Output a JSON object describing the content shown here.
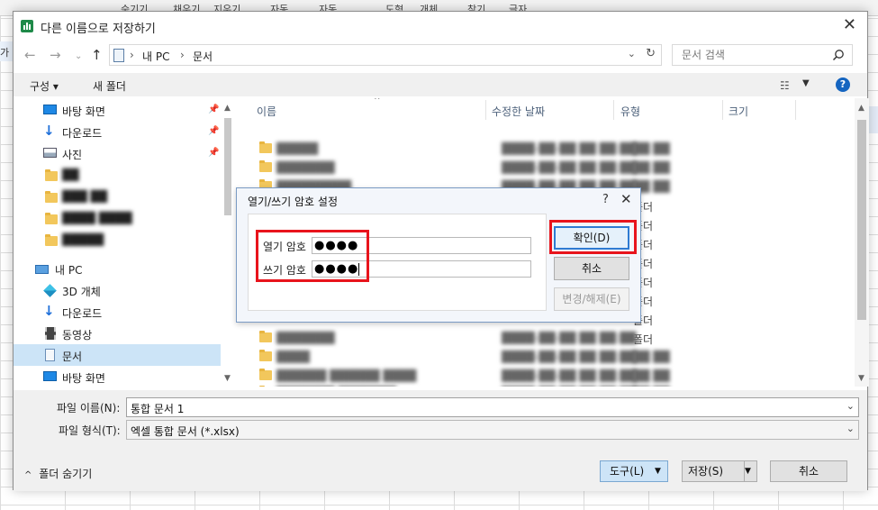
{
  "background": {
    "ribbon_items": [
      "숨기기",
      "채우기",
      "지우기",
      "자동",
      "자동",
      "도형",
      "개체",
      "찾기",
      "글자"
    ],
    "left_cell_text": "가"
  },
  "dialog": {
    "title": "다른 이름으로 저장하기",
    "close_label": "✕",
    "address": {
      "path_parts": [
        "내 PC",
        "문서"
      ]
    },
    "search": {
      "placeholder": "문서 검색"
    },
    "toolbar": {
      "organize_label": "구성 ▾",
      "new_folder_label": "새 폴더",
      "help_label": "?"
    },
    "nav": {
      "items": [
        {
          "label": "바탕 화면",
          "icon": "desktop-icon",
          "pinned": true
        },
        {
          "label": "다운로드",
          "icon": "download-icon",
          "pinned": true
        },
        {
          "label": "사진",
          "icon": "pictures-icon",
          "pinned": true
        },
        {
          "label": "██",
          "icon": "folder-icon",
          "blurred": true
        },
        {
          "label": "███ ██",
          "icon": "folder-icon",
          "blurred": true
        },
        {
          "label": "████ ████",
          "icon": "folder-icon",
          "blurred": true
        },
        {
          "label": "█████",
          "icon": "folder-icon",
          "blurred": true
        },
        {
          "label": "내 PC",
          "icon": "pc-icon"
        },
        {
          "label": "3D 개체",
          "icon": "3d-objects-icon"
        },
        {
          "label": "다운로드",
          "icon": "download-icon"
        },
        {
          "label": "동영상",
          "icon": "videos-icon"
        },
        {
          "label": "문서",
          "icon": "documents-icon",
          "selected": true
        },
        {
          "label": "바탕 화면",
          "icon": "desktop-icon"
        }
      ]
    },
    "columns": {
      "name": "이름",
      "modified": "수정한 날짜",
      "type": "유형",
      "size": "크기"
    },
    "files": [
      {
        "name": "█████",
        "date": "████-██-██ ██ ██:██",
        "type": "██ ██"
      },
      {
        "name": "███████",
        "date": "████-██-██ ██ ██:██",
        "type": "██ ██"
      },
      {
        "name": "█████████",
        "date": "████-██-██ ██ ██:██",
        "type": "██ ██"
      },
      {
        "name": "",
        "date": "",
        "type": "폴더"
      },
      {
        "name": "",
        "date": "",
        "type": "폴더"
      },
      {
        "name": "",
        "date": "",
        "type": "폴더"
      },
      {
        "name": "",
        "date": "",
        "type": "폴더"
      },
      {
        "name": "",
        "date": "",
        "type": "폴더"
      },
      {
        "name": "",
        "date": "",
        "type": "폴더"
      },
      {
        "name": "",
        "date": "",
        "type": "폴더"
      },
      {
        "name": "",
        "date": "",
        "type": "폴더"
      },
      {
        "name": "███████",
        "date": "████-██-██ ██ ██:██",
        "type": "██ ██"
      },
      {
        "name": "████",
        "date": "████-██-██ ██ ██:██",
        "type": "██ ██"
      },
      {
        "name": "██████ ██████ ████",
        "date": "████-██-██ ██ ██:██",
        "type": "██ ██"
      },
      {
        "name": "███████ ███████",
        "date": "████-██-██ ██ ██:██",
        "type": "██ ██"
      }
    ],
    "filename": {
      "label": "파일 이름(N):",
      "value": "통합 문서 1"
    },
    "filetype": {
      "label": "파일 형식(T):",
      "value": "엑셀 통합 문서 (*.xlsx)"
    },
    "hide_folders_label": "폴더 숨기기",
    "tools_label": "도구(L)",
    "save_label": "저장(S)",
    "cancel_label": "취소"
  },
  "password_dialog": {
    "title": "열기/쓰기 암호 설정",
    "help": "?",
    "close": "✕",
    "open_password": {
      "label": "열기 암호",
      "value": "●●●●"
    },
    "write_password": {
      "label": "쓰기 암호",
      "value": "●●●●"
    },
    "ok_label": "확인(D)",
    "cancel_label": "취소",
    "change_label": "변경/해제(E)",
    "highlight_color": "#e8141c"
  }
}
